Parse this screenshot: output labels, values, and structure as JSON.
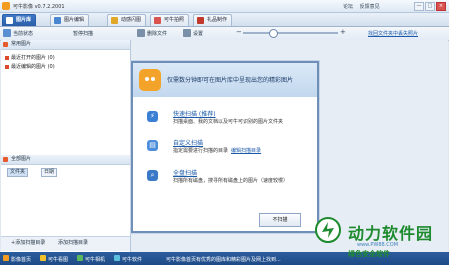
{
  "window": {
    "title": "可牛影像 v0.7.2.2001",
    "links": [
      "论坛",
      "反馈意见"
    ],
    "buttons": [
      "—",
      "□",
      "×"
    ]
  },
  "tabs": [
    {
      "label": "图片库",
      "active": true
    },
    {
      "label": "图片编辑",
      "active": false
    },
    {
      "label": "动感闪图",
      "active": false
    },
    {
      "label": "可牛拍照",
      "active": false
    },
    {
      "label": "礼品制作",
      "active": false
    }
  ],
  "toolbar": {
    "status_label": "当前状态",
    "stop_scan": "暂停扫描",
    "delete_file": "删除文件",
    "settings": "设置",
    "find_link": "找回文件夹中丢失照片"
  },
  "sidebar": {
    "recent_header": "常用图片",
    "recent_items": [
      "最近打开的图片 (0)",
      "最近编辑的图片 (0)"
    ],
    "all_header": "全部图片",
    "filters": [
      "文件夹",
      "日期"
    ],
    "add_scan": "+添加扫描目录",
    "add_folder": "添加扫描目录"
  },
  "dialog": {
    "title": "仅需数分钟即可在图片库中呈现出您的精彩图片",
    "options": [
      {
        "icon": "lightning-icon",
        "title": "快速扫描 (推荐)",
        "desc": "扫描桌面、我的文档以及可牛可识别的图片文件夹",
        "link": ""
      },
      {
        "icon": "folder-icon",
        "title": "自定义扫描",
        "desc": "指定需要进行扫描的目录",
        "link": "编辑扫描目录"
      },
      {
        "icon": "search-icon",
        "title": "全盘扫描",
        "desc": "扫描所有磁盘，搜寻所有磁盘上的图片（速度较慢）",
        "link": ""
      }
    ],
    "ok_button": "不扫描"
  },
  "statusbar": {
    "items": [
      "影像首页",
      "可牛看图",
      "可牛相机",
      "可牛软件"
    ],
    "message": "可牛影像首页有优秀的图库和精彩图片及网上找到..."
  },
  "watermark": {
    "title": "动力软件园",
    "url": "www.PW88.COM",
    "subtitle": "绿色安全软件"
  },
  "colors": {
    "accent": "#2a5ea8",
    "brand_orange": "#f3a32a",
    "watermark_green": "#1d8a2e"
  }
}
